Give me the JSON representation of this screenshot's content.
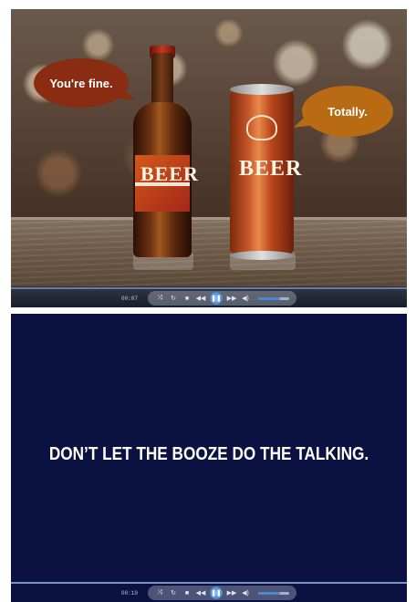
{
  "frame1": {
    "bubble_left": "You're fine.",
    "bubble_right": "Totally.",
    "bottle_label": "BEER",
    "can_label": "BEER",
    "player": {
      "timecode": "00:07",
      "volume": 0.7
    }
  },
  "frame2": {
    "slogan": "DON’T LET THE BOOZE DO THE TALKING.",
    "player": {
      "timecode": "00:10",
      "volume": 0.7
    }
  },
  "icons": [
    "pause-icon",
    "stop-icon",
    "previous-icon",
    "next-icon",
    "rewind-icon",
    "fast-forward-icon",
    "shuffle-icon",
    "repeat-icon",
    "mute-icon"
  ],
  "colors": {
    "bubble_left": "#8a2c12",
    "bubble_right": "#b86b12",
    "slide_bg": "#0b1140",
    "player_accent": "#4f86d1"
  }
}
